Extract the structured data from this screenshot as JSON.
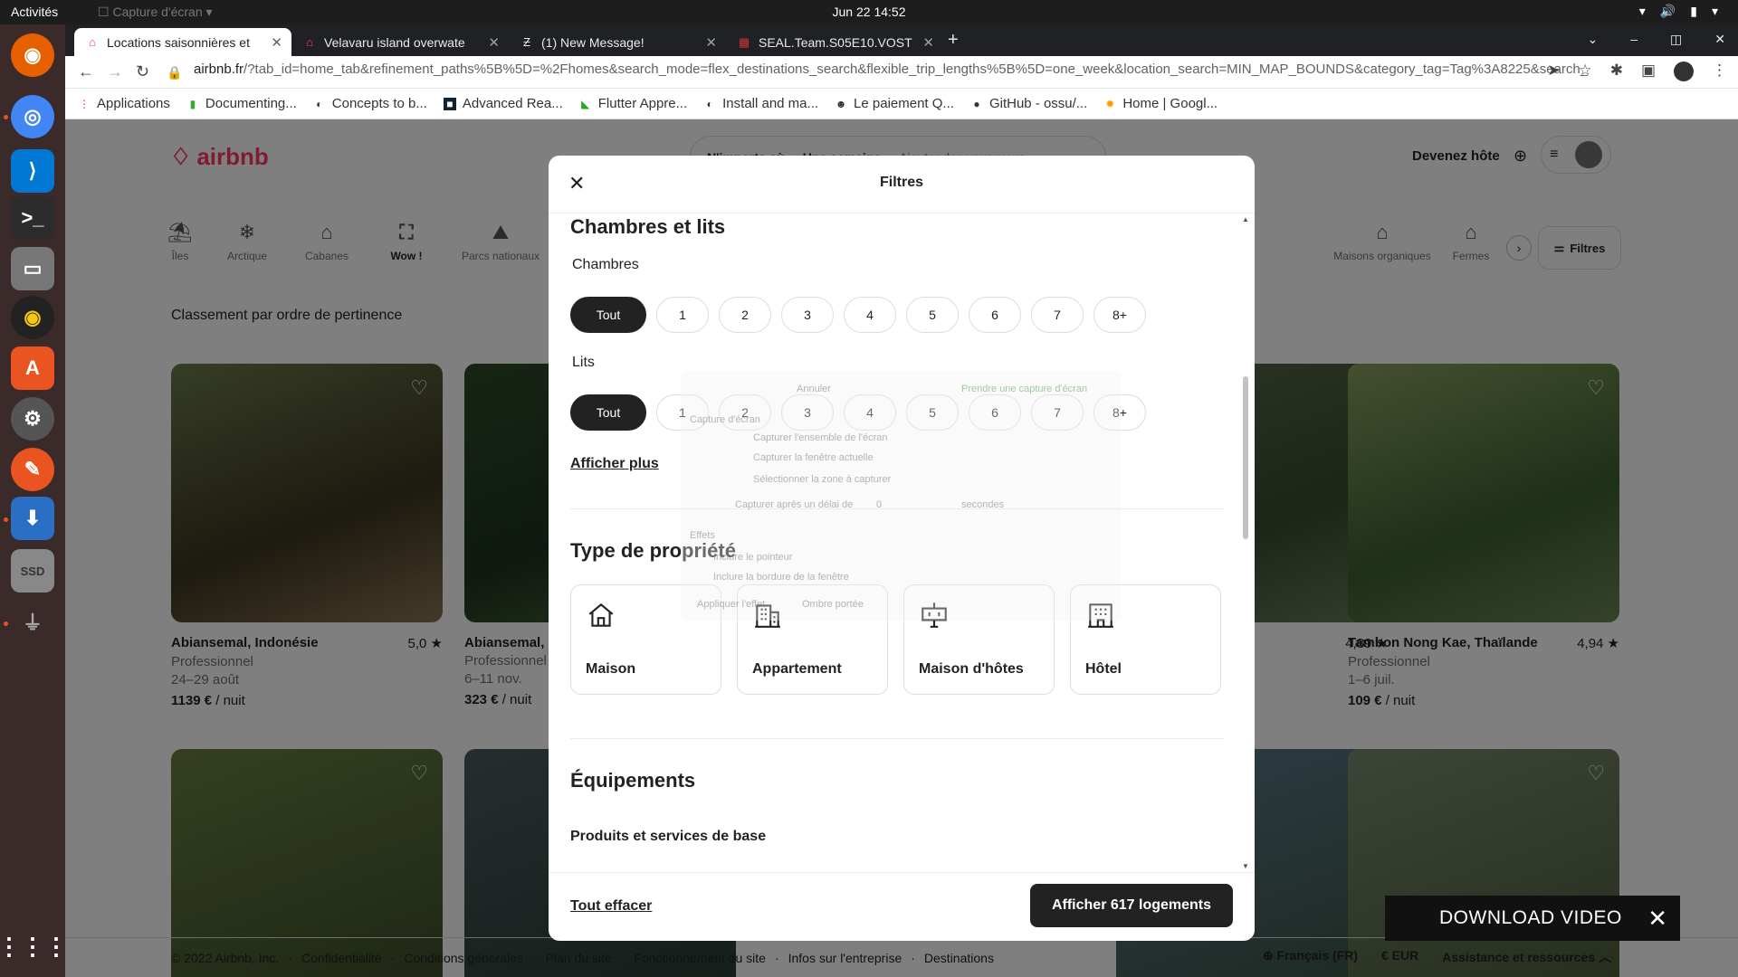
{
  "system": {
    "activities": "Activités",
    "capture_app": "Capture d'écran",
    "clock": "Jun 22  14:52"
  },
  "browser": {
    "tabs": [
      {
        "title": "Locations saisonnières et",
        "active": true
      },
      {
        "title": "Velavaru island overwate",
        "active": false
      },
      {
        "title": "(1) New Message!",
        "active": false
      },
      {
        "title": "SEAL.Team.S05E10.VOST",
        "active": false
      }
    ],
    "url_host": "airbnb.fr",
    "url_path": "/?tab_id=home_tab&refinement_paths%5B%5D=%2Fhomes&search_mode=flex_destinations_search&flexible_trip_lengths%5B%5D=one_week&location_search=MIN_MAP_BOUNDS&category_tag=Tag%3A8225&search_type...",
    "bookmarks": [
      "Applications",
      "Documenting...",
      "Concepts to b...",
      "Advanced Rea...",
      "Flutter Appre...",
      "Install and ma...",
      "Le paiement Q...",
      "GitHub - ossu/...",
      "Home | Googl..."
    ]
  },
  "page": {
    "logo": "airbnb",
    "search": {
      "where": "N'importe où",
      "when": "Une semaine",
      "who": "Ajouter des voyageurs"
    },
    "become_host": "Devenez hôte",
    "categories": [
      "Îles",
      "Arctique",
      "Cabanes",
      "Wow !",
      "Parcs nationaux",
      "Maisons organiques",
      "Fermes"
    ],
    "filters_label": "Filtres",
    "sort": "Classement par ordre de pertinence",
    "listings": [
      {
        "title": "Abiansemal, Indonésie",
        "rating": "5,0 ★",
        "host": "Professionnel",
        "dates": "24–29 août",
        "price": "1139 €",
        "unit": " / nuit"
      },
      {
        "title": "Abiansemal, I",
        "rating": "",
        "host": "Professionnel",
        "dates": "6–11 nov.",
        "price": "323 €",
        "unit": " / nuit"
      },
      {
        "title": "",
        "rating": "4,89 ★",
        "host": "",
        "dates": "",
        "price": "",
        "unit": ""
      },
      {
        "title": "Tambon Nong Kae, Thaïlande",
        "rating": "4,94 ★",
        "host": "Professionnel",
        "dates": "1–6 juil.",
        "price": "109 €",
        "unit": " / nuit"
      }
    ],
    "footer": {
      "copyright": "© 2022 Airbnb, Inc.",
      "links": [
        "Confidentialité",
        "Conditions générales",
        "Plan du site",
        "Fonctionnement du site",
        "Infos sur l'entreprise",
        "Destinations"
      ],
      "language": "Français (FR)",
      "currency": "€  EUR",
      "help": "Assistance et ressources"
    }
  },
  "modal": {
    "title": "Filtres",
    "rooms_section": "Chambres et lits",
    "bedrooms_label": "Chambres",
    "beds_label": "Lits",
    "options": [
      "Tout",
      "1",
      "2",
      "3",
      "4",
      "5",
      "6",
      "7",
      "8+"
    ],
    "show_more": "Afficher plus",
    "property_section": "Type de propriété",
    "property_types": [
      "Maison",
      "Appartement",
      "Maison d'hôtes",
      "Hôtel"
    ],
    "amenities_section": "Équipements",
    "amenities_sub": "Produits et services de base",
    "clear_all": "Tout effacer",
    "show_button": "Afficher 617 logements"
  },
  "ghost_dialog": {
    "cancel": "Annuler",
    "take": "Prendre une capture d'écran",
    "capture_area": "Capture d'écran",
    "opt1": "Capturer l'ensemble de l'écran",
    "opt2": "Capturer la fenêtre actuelle",
    "opt3": "Sélectionner la zone à capturer",
    "delay": "Capturer après un délai de",
    "delay_value": "0",
    "seconds": "secondes",
    "effects": "Effets",
    "pointer": "Inclure le pointeur",
    "border": "Inclure la bordure de la fenêtre",
    "apply": "Appliquer l'effet",
    "shadow": "Ombre portée"
  },
  "download_bar": {
    "label": "DOWNLOAD VIDEO"
  },
  "colors": {
    "brand": "#ff385c",
    "selected_pill": "#222222"
  }
}
